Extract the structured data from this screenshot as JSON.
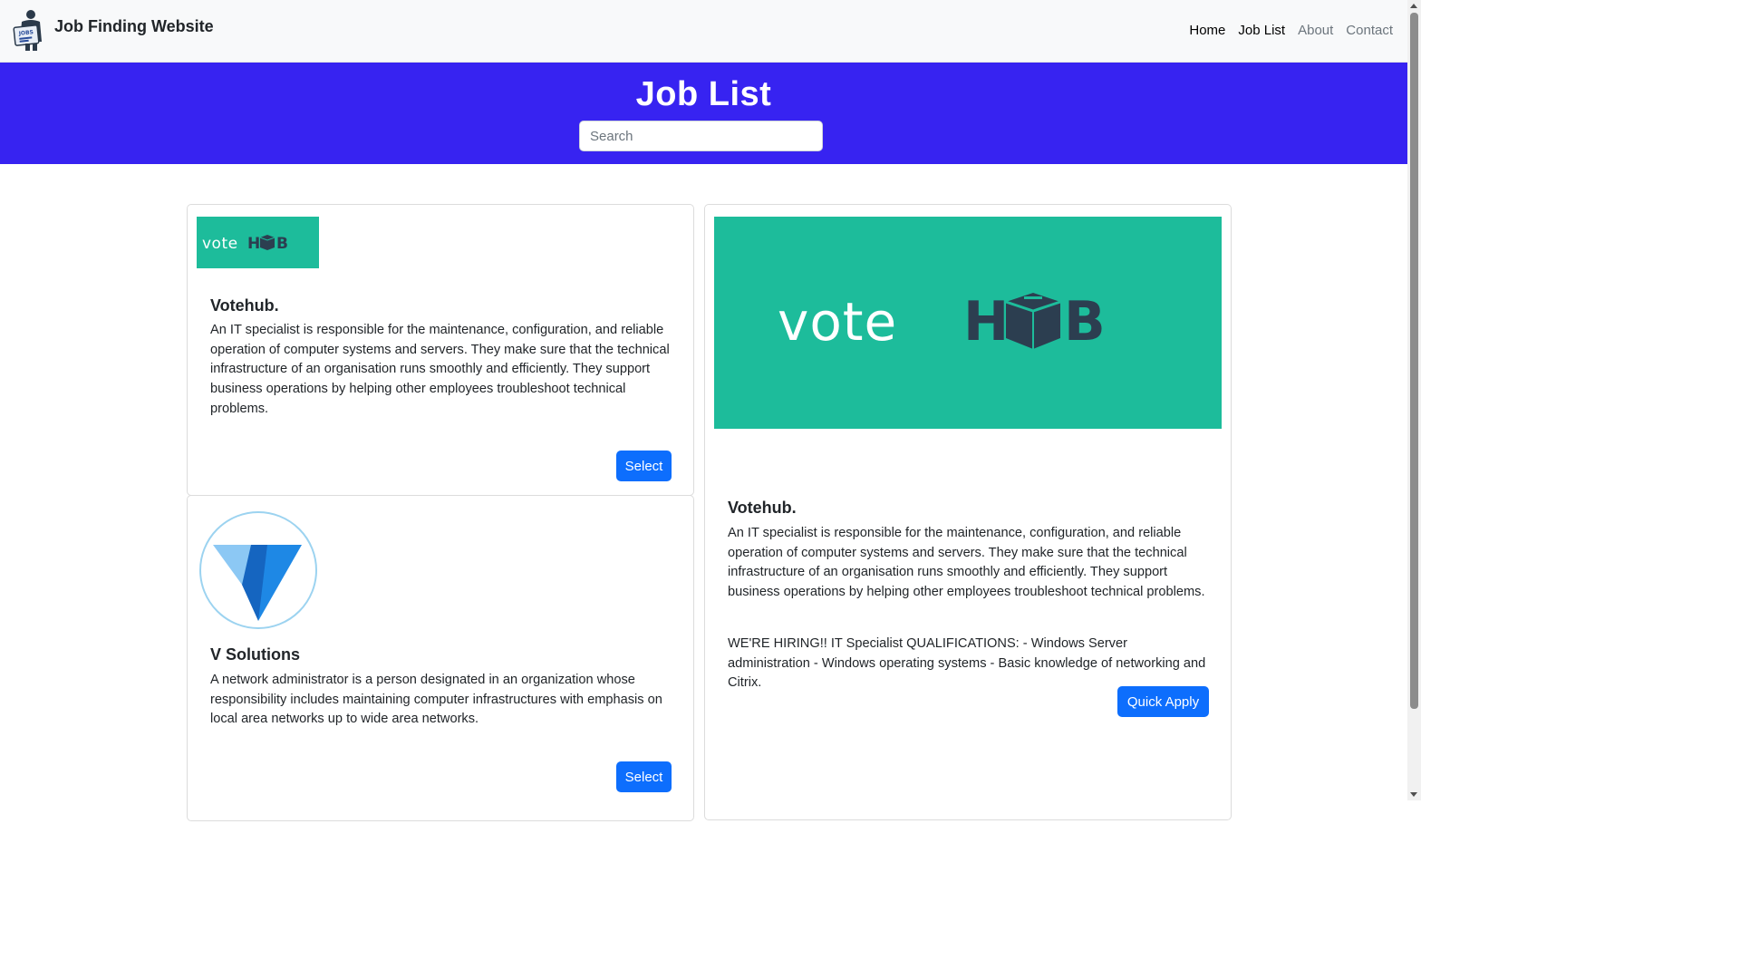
{
  "navbar": {
    "brand": "Job Finding Website",
    "links": [
      {
        "label": "Home"
      },
      {
        "label": "Job List"
      },
      {
        "label": "About"
      },
      {
        "label": "Contact"
      }
    ]
  },
  "hero": {
    "title": "Job List",
    "search_placeholder": "Search"
  },
  "logos": {
    "votehub_text_left": "vote",
    "votehub_text_right": "H",
    "votehub_text_end": "B"
  },
  "jobs": [
    {
      "company": "Votehub.",
      "description": "An IT specialist is responsible for the maintenance, configuration, and reliable operation of computer systems and servers. They make sure that the technical infrastructure of an organisation runs smoothly and efficiently. They support business operations by helping other employees troubleshoot technical problems.",
      "button": "Select"
    },
    {
      "company": "V Solutions",
      "description": "A network administrator is a person designated in an organization whose responsibility includes maintaining computer infrastructures with emphasis on local area networks up to wide area networks.",
      "button": "Select"
    }
  ],
  "detail": {
    "company": "Votehub.",
    "description": "An IT specialist is responsible for the maintenance, configuration, and reliable operation of computer systems and servers. They make sure that the technical infrastructure of an organisation runs smoothly and efficiently. They support business operations by helping other employees troubleshoot technical problems.",
    "qualifications": "WE'RE HIRING!! IT Specialist QUALIFICATIONS: - Windows Server administration - Windows operating systems - Basic knowledge of networking and Citrix.",
    "button": "Quick Apply"
  },
  "colors": {
    "hero_bg": "#3723f1",
    "votehub_green": "#1dbc9b",
    "votehub_dark": "#2c3e50",
    "button_blue": "#0d6efd"
  }
}
